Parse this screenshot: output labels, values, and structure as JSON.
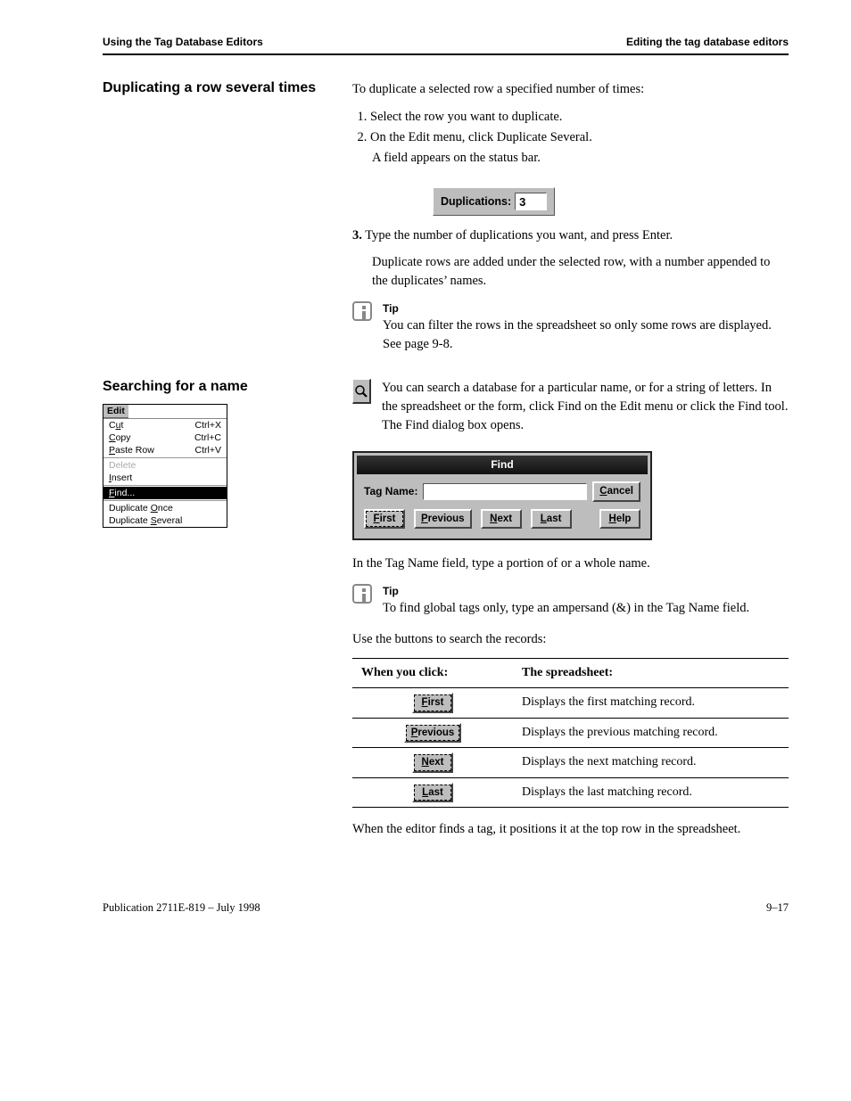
{
  "header": {
    "left": "Using the Tag Database Editors",
    "right": "Editing the tag database editors"
  },
  "sec1": {
    "title": "Duplicating a row several times",
    "intro": "To duplicate a selected row a specified number of times:",
    "steps": [
      "Select the row you want to duplicate.",
      "On the Edit menu, click Duplicate Several."
    ],
    "result": "A field appears on the status bar.",
    "dup_label": "Duplications:",
    "dup_value": "3",
    "step3_lead": "3.",
    "step3_body": "Type the number of duplications you want, and press Enter.",
    "outcome": "Duplicate rows are added under the selected row, with a number appended to the duplicates’ names.",
    "tip_label": "Tip",
    "tip_body": "You can filter the rows in the spreadsheet so only some rows are displayed. See page 9-8."
  },
  "sec2": {
    "title": "Searching for a name",
    "intro_icon_label": "Search icon",
    "intro": "You can search a database for a particular name, or for a string of letters. In the spreadsheet or the form, click Find on the Edit menu or click the Find tool. The Find dialog box opens.",
    "menu": {
      "title": "Edit",
      "items": [
        {
          "label": "Cut",
          "short": "Ctrl+X"
        },
        {
          "label": "Copy",
          "short": "Ctrl+C"
        },
        {
          "label": "Paste Row",
          "short": "Ctrl+V"
        }
      ],
      "disabled": "Delete",
      "insert": "Insert",
      "find": "Find...",
      "dup1": "Duplicate Once",
      "dup2": "Duplicate Several"
    },
    "find_dialog": {
      "title": "Find",
      "tagname_label": "Tag Name:",
      "tagname_value": "",
      "buttons": {
        "first": "First",
        "previous": "Previous",
        "next": "Next",
        "last": "Last",
        "cancel": "Cancel",
        "help": "Help"
      }
    },
    "after_dialog_1": "In the Tag Name field, type a portion of or a whole name.",
    "tip2_label": "Tip",
    "tip2_body": "To find global tags only, type an ampersand (&) in the Tag Name field.",
    "after_dialog_2": "Use the buttons to search the records:",
    "table": {
      "head": [
        "When you click:",
        "The spreadsheet:"
      ],
      "rows": [
        {
          "btn": "First",
          "desc": "Displays the first matching record."
        },
        {
          "btn": "Previous",
          "desc": "Displays the previous matching record."
        },
        {
          "btn": "Next",
          "desc": "Displays the next matching record."
        },
        {
          "btn": "Last",
          "desc": "Displays the last matching record."
        }
      ]
    },
    "closing": "When the editor finds a tag, it positions it at the top row in the spreadsheet."
  },
  "footer": {
    "left": "Publication 2711E-819 – July 1998",
    "right": "9–17"
  }
}
